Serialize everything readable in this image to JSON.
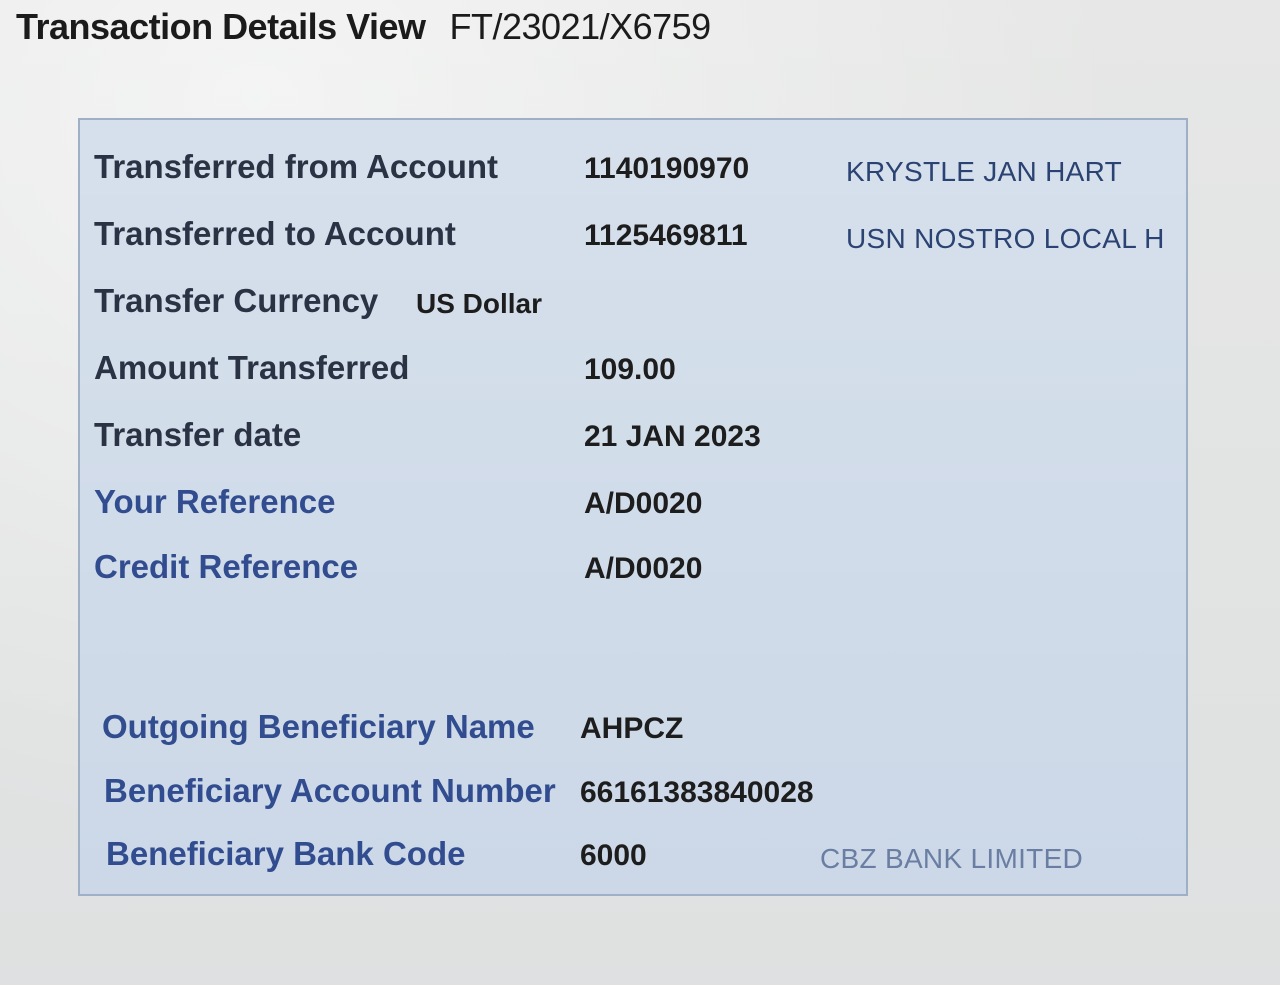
{
  "header": {
    "title": "Transaction Details View",
    "transaction_id": "FT/23021/X6759"
  },
  "details": {
    "from_account": {
      "label": "Transferred from Account",
      "value": "1140190970",
      "name": "KRYSTLE JAN HART"
    },
    "to_account": {
      "label": "Transferred to Account",
      "value": "1125469811",
      "name": "USN NOSTRO LOCAL H"
    },
    "currency": {
      "label": "Transfer Currency",
      "value": "US Dollar"
    },
    "amount": {
      "label": "Amount Transferred",
      "value": "109.00"
    },
    "date": {
      "label": "Transfer date",
      "value": "21 JAN 2023"
    },
    "your_reference": {
      "label": "Your Reference",
      "value": "A/D0020"
    },
    "credit_reference": {
      "label": "Credit Reference",
      "value": "A/D0020"
    },
    "beneficiary_name": {
      "label": "Outgoing Beneficiary Name",
      "value": "AHPCZ"
    },
    "beneficiary_account": {
      "label": "Beneficiary Account Number",
      "value": "66161383840028"
    },
    "beneficiary_bank_code": {
      "label": "Beneficiary Bank Code",
      "value": "6000",
      "name": "CBZ BANK LIMITED"
    }
  },
  "colors": {
    "panel_background": "#c9d6e6",
    "label_dark": "#2a3344",
    "label_blue": "#324d8f",
    "value_text": "#1d1d1d",
    "account_name_text": "#2b4372"
  }
}
